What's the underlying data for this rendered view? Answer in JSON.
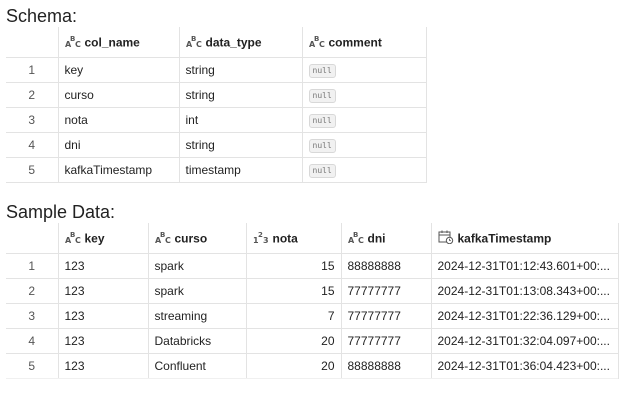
{
  "schema": {
    "title": "Schema:",
    "columns": [
      {
        "label": "col_name",
        "type_icon": "abc-type-icon"
      },
      {
        "label": "data_type",
        "type_icon": "abc-type-icon"
      },
      {
        "label": "comment",
        "type_icon": "abc-type-icon"
      }
    ],
    "rows": [
      {
        "index": "1",
        "col_name": "key",
        "data_type": "string",
        "comment": "null"
      },
      {
        "index": "2",
        "col_name": "curso",
        "data_type": "string",
        "comment": "null"
      },
      {
        "index": "3",
        "col_name": "nota",
        "data_type": "int",
        "comment": "null"
      },
      {
        "index": "4",
        "col_name": "dni",
        "data_type": "string",
        "comment": "null"
      },
      {
        "index": "5",
        "col_name": "kafkaTimestamp",
        "data_type": "timestamp",
        "comment": "null"
      }
    ]
  },
  "sample": {
    "title": "Sample Data:",
    "columns": [
      {
        "label": "key",
        "type_icon": "abc-type-icon"
      },
      {
        "label": "curso",
        "type_icon": "abc-type-icon"
      },
      {
        "label": "nota",
        "type_icon": "numeric-type-icon"
      },
      {
        "label": "dni",
        "type_icon": "abc-type-icon"
      },
      {
        "label": "kafkaTimestamp",
        "type_icon": "calendar-clock-icon"
      }
    ],
    "rows": [
      {
        "index": "1",
        "key": "123",
        "curso": "spark",
        "nota": "15",
        "dni": "88888888",
        "kafkaTimestamp": "2024-12-31T01:12:43.601+00:..."
      },
      {
        "index": "2",
        "key": "123",
        "curso": "spark",
        "nota": "15",
        "dni": "77777777",
        "kafkaTimestamp": "2024-12-31T01:13:08.343+00:..."
      },
      {
        "index": "3",
        "key": "123",
        "curso": "streaming",
        "nota": "7",
        "dni": "77777777",
        "kafkaTimestamp": "2024-12-31T01:22:36.129+00:..."
      },
      {
        "index": "4",
        "key": "123",
        "curso": "Databricks",
        "nota": "20",
        "dni": "77777777",
        "kafkaTimestamp": "2024-12-31T01:32:04.097+00:..."
      },
      {
        "index": "5",
        "key": "123",
        "curso": "Confluent",
        "nota": "20",
        "dni": "88888888",
        "kafkaTimestamp": "2024-12-31T01:36:04.423+00:..."
      }
    ]
  }
}
